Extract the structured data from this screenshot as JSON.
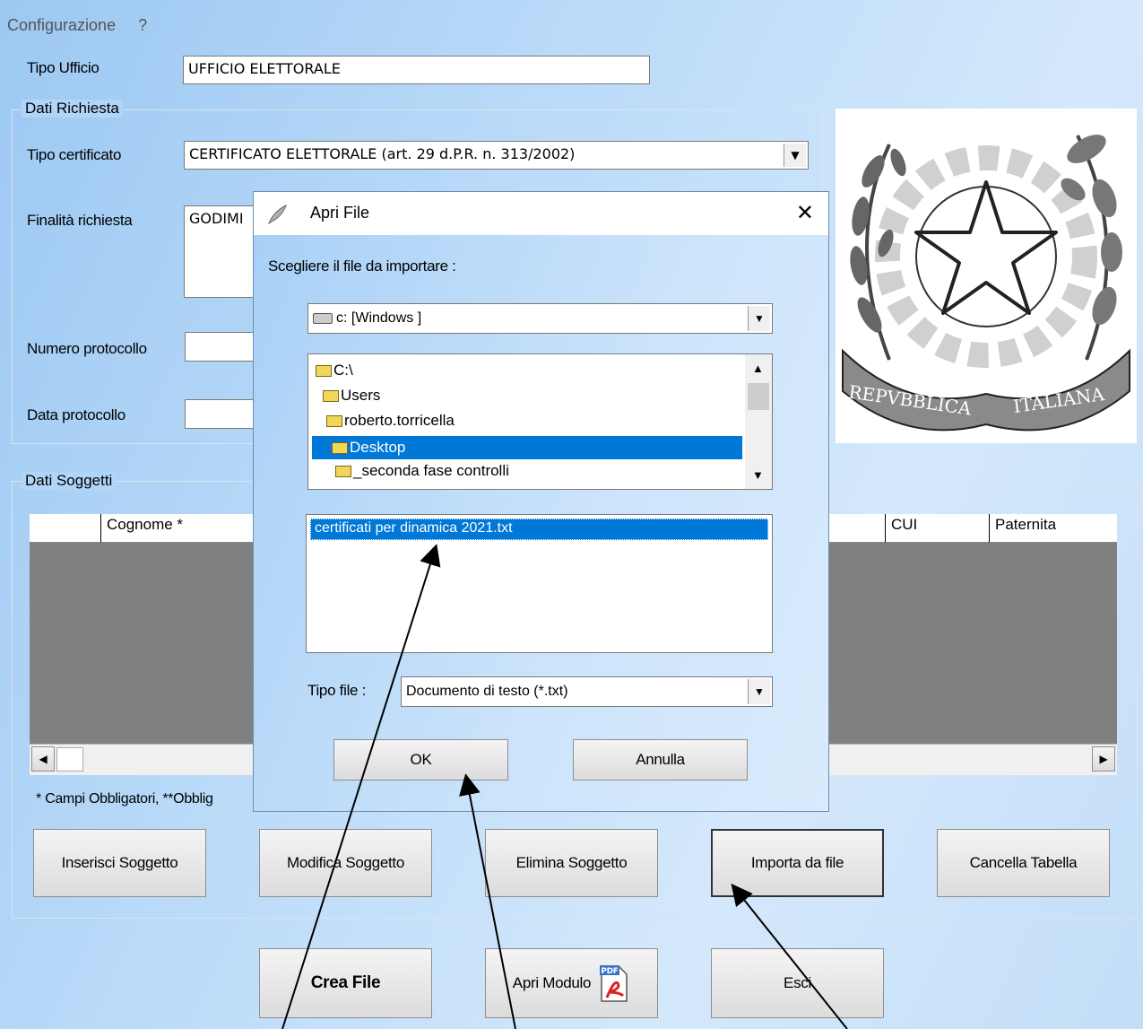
{
  "menu": {
    "config": "Configurazione",
    "help": "?"
  },
  "tipo_ufficio": {
    "label": "Tipo Ufficio",
    "value": "UFFICIO ELETTORALE"
  },
  "dati_richiesta": {
    "legend": "Dati Richiesta",
    "tipo_certificato": {
      "label": "Tipo certificato",
      "value": "CERTIFICATO ELETTORALE (art. 29 d.P.R. n. 313/2002)"
    },
    "finalita": {
      "label": "Finalità richiesta",
      "value": "GODIMI"
    },
    "numero_protocollo": {
      "label": "Numero protocollo",
      "value": ""
    },
    "data_protocollo": {
      "label": "Data protocollo",
      "value": ""
    }
  },
  "emblem": {
    "motto_left": "REPVBBLICA",
    "motto_right": "ITALIANA"
  },
  "dati_soggetti": {
    "legend": "Dati Soggetti",
    "columns": [
      "Cognome *",
      "CUI",
      "Paternita"
    ],
    "footnote": "* Campi Obbligatori, **Obblig"
  },
  "buttons": {
    "inserisci": "Inserisci Soggetto",
    "modifica": "Modifica Soggetto",
    "elimina": "Elimina Soggetto",
    "importa": "Importa da file",
    "cancella": "Cancella Tabella",
    "crea": "Crea File",
    "apri_modulo": "Apri Modulo",
    "esci": "Esci"
  },
  "dialog": {
    "title": "Apri File",
    "close": "✕",
    "prompt": "Scegliere il file da importare :",
    "drive": "c: [Windows ]",
    "folders": [
      "C:\\",
      "Users",
      "roberto.torricella",
      "Desktop",
      "_seconda fase controlli"
    ],
    "selected_folder_index": 3,
    "files": [
      "certificati per dinamica 2021.txt"
    ],
    "filetype_label": "Tipo file :",
    "filetype_value": "Documento di testo (*.txt)",
    "ok": "OK",
    "cancel": "Annulla"
  },
  "icons": {
    "dropdown": "chevron-down-icon",
    "pdf": "pdf-icon",
    "drive": "drive-icon",
    "folder": "folder-icon"
  },
  "colors": {
    "selection": "#0078d7",
    "grid_bg": "#808080",
    "window_bg": "#b8daf8"
  }
}
